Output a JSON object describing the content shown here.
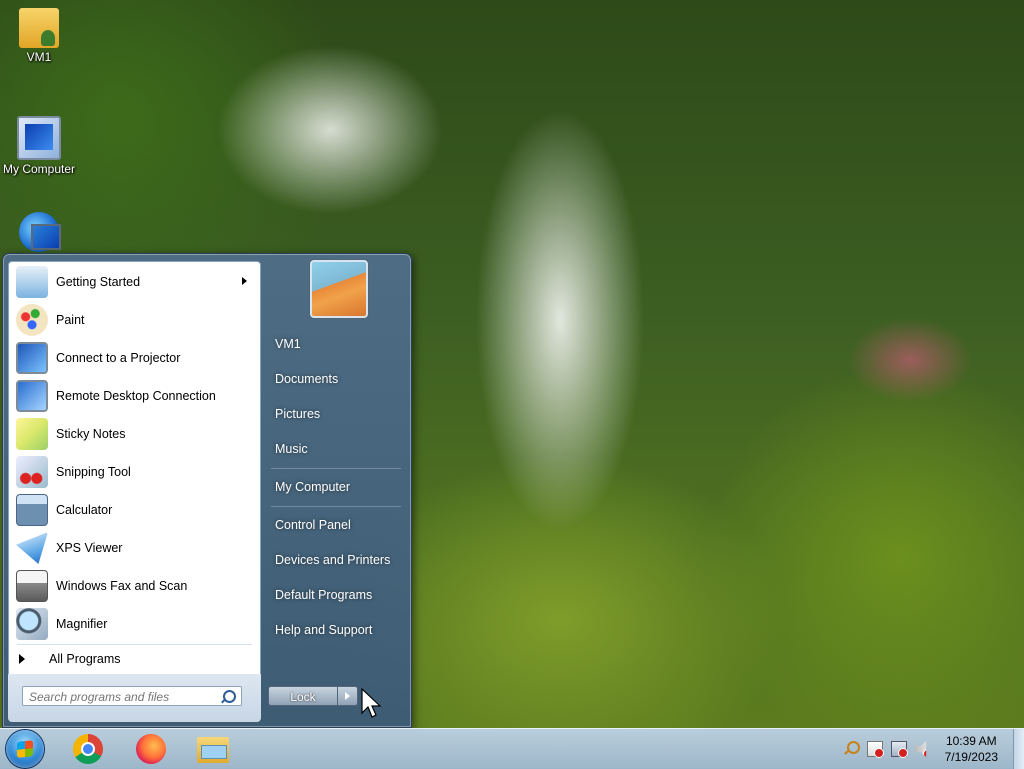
{
  "desktop": {
    "icons": [
      {
        "label": "VM1",
        "icon": "user-folder-icon"
      },
      {
        "label": "My Computer",
        "icon": "computer-icon"
      },
      {
        "label": "",
        "icon": "network-globe-icon"
      }
    ]
  },
  "start_menu": {
    "programs": [
      {
        "label": "Getting Started",
        "icon": "getting-started-icon",
        "has_submenu": true
      },
      {
        "label": "Paint",
        "icon": "paint-icon"
      },
      {
        "label": "Connect to a Projector",
        "icon": "projector-icon"
      },
      {
        "label": "Remote Desktop Connection",
        "icon": "remote-desktop-icon"
      },
      {
        "label": "Sticky Notes",
        "icon": "sticky-notes-icon"
      },
      {
        "label": "Snipping Tool",
        "icon": "snipping-tool-icon"
      },
      {
        "label": "Calculator",
        "icon": "calculator-icon"
      },
      {
        "label": "XPS Viewer",
        "icon": "xps-viewer-icon"
      },
      {
        "label": "Windows Fax and Scan",
        "icon": "fax-scan-icon"
      },
      {
        "label": "Magnifier",
        "icon": "magnifier-icon"
      }
    ],
    "all_programs": "All Programs",
    "search_placeholder": "Search programs and files",
    "right_links": [
      {
        "label": "VM1"
      },
      {
        "label": "Documents"
      },
      {
        "label": "Pictures"
      },
      {
        "label": "Music"
      },
      {
        "label": "My Computer"
      },
      {
        "label": "Control Panel"
      },
      {
        "label": "Devices and Printers"
      },
      {
        "label": "Default Programs"
      },
      {
        "label": "Help and Support"
      }
    ],
    "lock_label": "Lock"
  },
  "taskbar": {
    "pinned": [
      "chrome-icon",
      "firefox-icon",
      "file-explorer-icon"
    ],
    "clock": {
      "time": "10:39 AM",
      "date": "7/19/2023"
    }
  }
}
